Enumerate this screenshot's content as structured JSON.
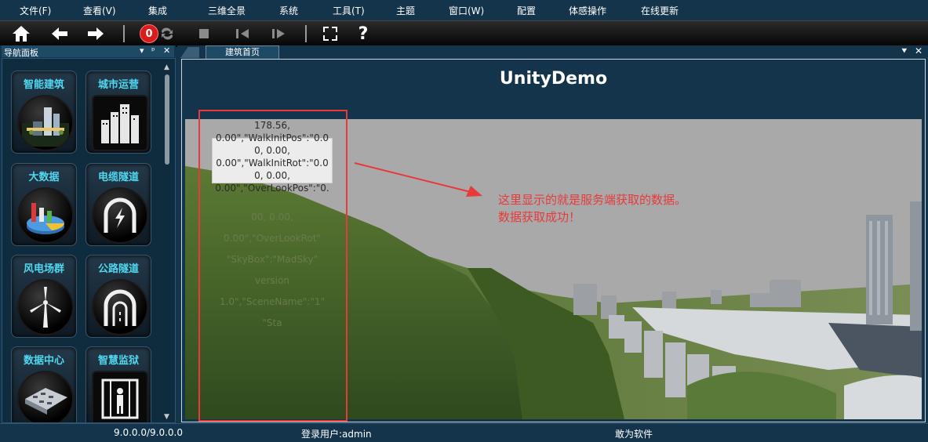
{
  "menu": [
    "文件(F)",
    "查看(V)",
    "集成",
    "三维全景",
    "系统",
    "工具(T)",
    "主题",
    "窗口(W)",
    "配置",
    "体感操作",
    "在线更新"
  ],
  "toolbar": {
    "home_icon": "house-icon",
    "back_icon": "arrow-left-icon",
    "forward_icon": "arrow-right-icon",
    "badge_count": "0",
    "refresh_icon": "refresh-icon",
    "stop_icon": "stop-icon",
    "prev_icon": "step-back-icon",
    "next_icon": "step-forward-icon",
    "fullscreen_icon": "fullscreen-icon",
    "help_label": "?"
  },
  "nav_panel": {
    "title": "导航面板",
    "controls": [
      "▾",
      "ᵖ",
      "✕"
    ],
    "tiles": [
      {
        "label": "智能建筑",
        "icon": "smart-building-icon"
      },
      {
        "label": "城市运营",
        "icon": "city-operation-icon"
      },
      {
        "label": "大数据",
        "icon": "big-data-chart-icon"
      },
      {
        "label": "电缆隧道",
        "icon": "cable-tunnel-icon"
      },
      {
        "label": "风电场群",
        "icon": "wind-turbine-icon"
      },
      {
        "label": "公路隧道",
        "icon": "road-tunnel-icon"
      },
      {
        "label": "数据中心",
        "icon": "data-center-icon"
      },
      {
        "label": "智慧监狱",
        "icon": "smart-prison-icon"
      }
    ]
  },
  "tabs": {
    "active": "建筑首页",
    "controls": [
      "⯆",
      "✕"
    ]
  },
  "content": {
    "title": "UnityDemo",
    "overlay_lines_top": [
      "178.56,",
      "0.00\",\"WalkInitPos\":\"0.0",
      "0, 0.00,",
      "0.00\",\"WalkInitRot\":\"0.0",
      "0, 0.00,",
      "0.00\",\"OverLookPos\":\"0."
    ],
    "overlay_lines_faded": [
      "00, 0.00,",
      "0.00\",\"OverLookRot\"",
      "\"SkyBox\":\"MadSky\"",
      "version",
      "1.0\",\"SceneName\":\"1\"",
      "\"Sta"
    ],
    "annotation_lines": [
      "这里显示的就是服务端获取的数据。",
      "数据获取成功！"
    ]
  },
  "status_bar": {
    "version": "9.0.0.0/9.0.0.0",
    "user": "登录用户:admin",
    "company": "敢为软件"
  },
  "colors": {
    "background": "#13344a",
    "tile_label": "#4fd8f0",
    "annotation": "#e83a3a"
  }
}
